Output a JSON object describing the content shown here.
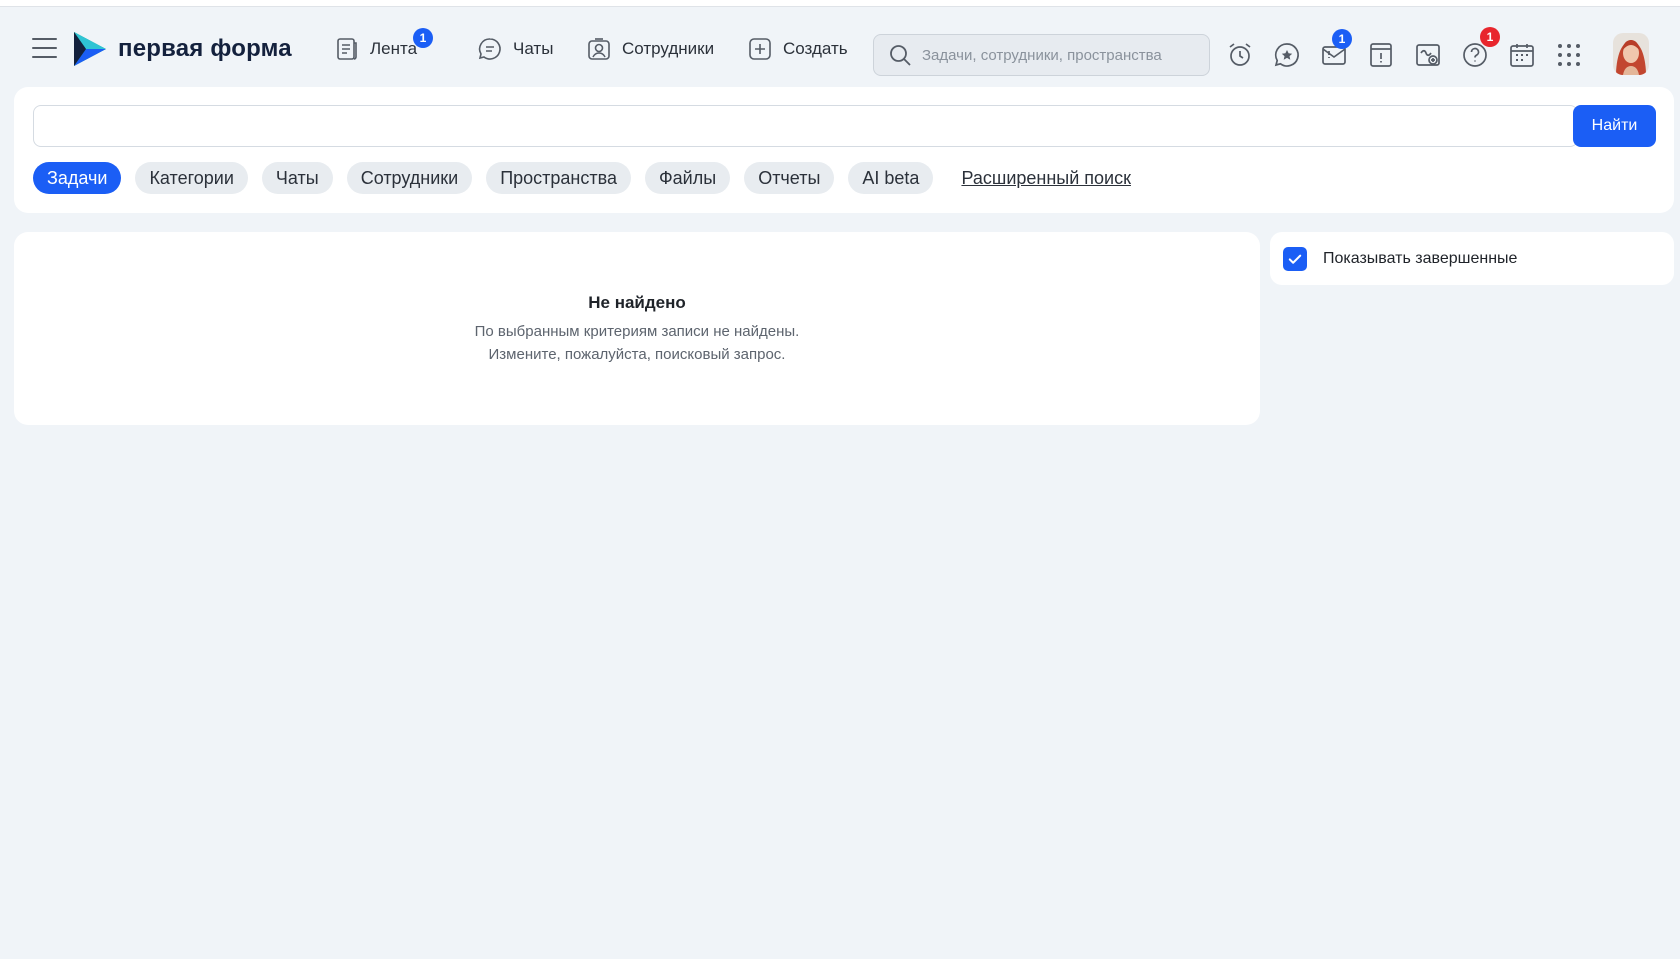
{
  "header": {
    "logo_text": "первая форма",
    "nav": [
      {
        "label": "Лента",
        "badge": "1"
      },
      {
        "label": "Чаты"
      },
      {
        "label": "Сотрудники"
      },
      {
        "label": "Создать"
      }
    ],
    "search_placeholder": "Задачи, сотрудники, пространства",
    "icons": [
      "alarm-clock-icon",
      "star-chat-icon",
      "mail-alert-icon",
      "alert-icon",
      "document-edit-icon",
      "help-icon",
      "calendar-icon",
      "apps-grid-icon"
    ],
    "mail_badge": "1",
    "help_badge": "1"
  },
  "search": {
    "query": "",
    "find_label": "Найти",
    "tabs": [
      "Задачи",
      "Категории",
      "Чаты",
      "Сотрудники",
      "Пространства",
      "Файлы",
      "Отчеты",
      "AI beta"
    ],
    "active_tab": "Задачи",
    "advanced_label": "Расширенный поиск"
  },
  "results": {
    "title": "Не найдено",
    "line1": "По выбранным критериям записи не найдены.",
    "line2": "Измените, пожалуйста, поисковый запрос."
  },
  "side": {
    "show_completed_label": "Показывать завершенные",
    "show_completed": true
  },
  "colors": {
    "accent": "#1b5ef5",
    "badge_red": "#e8262d",
    "background": "#f0f4f8"
  }
}
